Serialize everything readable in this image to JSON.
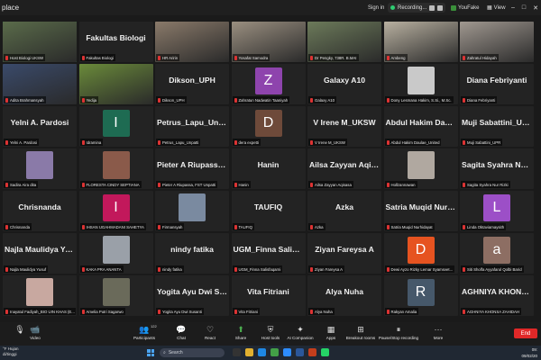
{
  "topbar": {
    "app_title": "place",
    "sign_in": "Sign in",
    "recording": "Recording...",
    "youfake": "YouFake",
    "view": "View",
    "minimize": "–",
    "maximize": "□",
    "close": "✕"
  },
  "tiles": [
    {
      "label": "Host Biologi UKSW",
      "type": "video",
      "color": "#5a6b4a",
      "active": true
    },
    {
      "label": "Fakultas Biologi",
      "type": "text",
      "name": "Fakultas Biologi"
    },
    {
      "label": "HR Aririn",
      "type": "video",
      "color": "#8a7a6a"
    },
    {
      "label": "Yosafat Samodra",
      "type": "video",
      "color": "#9a8f80"
    },
    {
      "label": "Dr Pengky, 738R. B.MAI",
      "type": "video",
      "color": "#6c7a5a"
    },
    {
      "label": "Ambeng",
      "type": "video",
      "color": "#b8b0a0"
    },
    {
      "label": "Zahratul Hidayah",
      "type": "video",
      "color": "#a09890"
    },
    {
      "label": "Adita Brahmansyah",
      "type": "video",
      "color": "#3a4a6a"
    },
    {
      "label": "Yedija",
      "type": "video",
      "color": "#6a8a3a"
    },
    {
      "label": "Dikson_UPH",
      "type": "text",
      "name": "Dikson_UPH"
    },
    {
      "label": "Zahratun Nadwatin Taaniyah",
      "type": "avatar",
      "letter": "Z",
      "color": "#8e44ad"
    },
    {
      "label": "Galaxy A10",
      "type": "text",
      "name": "Galaxy A10"
    },
    {
      "label": "Dony Lesmana Hakim, S.Si., M.Sc.",
      "type": "photo",
      "color": "#c9c9c9"
    },
    {
      "label": "Diana Febriyanti",
      "type": "text",
      "name": "Diana Febriyanti"
    },
    {
      "label": "Yelni A. Pardosi",
      "type": "text",
      "name": "Yelni A. Pardosi"
    },
    {
      "label": "Idramina",
      "type": "avatar",
      "letter": "I",
      "color": "#1e6b52"
    },
    {
      "label": "Petrus_Lapu_Unpatti",
      "type": "text",
      "name": "Petrus_Lapu_Unpatti"
    },
    {
      "label": "dera expetti",
      "type": "avatar",
      "letter": "D",
      "color": "#6e4a3a"
    },
    {
      "label": "V Irene M_UKSW",
      "type": "text",
      "name": "V Irene M_UKSW"
    },
    {
      "label": "Abdul Hakim Daulae_United",
      "type": "text",
      "name": "Abdul Hakim Daulae_United"
    },
    {
      "label": "Muji Sabattini_UPR",
      "type": "text",
      "name": "Muji Sabattini_UPR"
    },
    {
      "label": "Sadira Aira dita",
      "type": "photo",
      "color": "#8a7aa8"
    },
    {
      "label": "FLORESTA CINDY SEPTIANA",
      "type": "photo",
      "color": "#8a5a4a"
    },
    {
      "label": "Pieter A Riupassa, FST Unpatti",
      "type": "text",
      "name": "Pieter A Riupassa, FST Unpatti"
    },
    {
      "label": "Hanin",
      "type": "text",
      "name": "Hanin"
    },
    {
      "label": "Ailsa Zayyan Aqisasa",
      "type": "text",
      "name": "Ailsa Zayyan Aqisasa"
    },
    {
      "label": "Hollzannawan",
      "type": "photo",
      "color": "#b0a8a0"
    },
    {
      "label": "Sagita Syahra Nur Rizki",
      "type": "text",
      "name": "Sagita Syahra Nur Rizki"
    },
    {
      "label": "Chrisnanda",
      "type": "text",
      "name": "Chrisnanda"
    },
    {
      "label": "IHSAN UGAHMADANI SAHETYA",
      "type": "avatar",
      "letter": "I",
      "color": "#c2185b"
    },
    {
      "label": "Firmansyah",
      "type": "photo",
      "color": "#7a8aa0"
    },
    {
      "label": "TAUFIQ",
      "type": "text",
      "name": "TAUFIQ"
    },
    {
      "label": "Azka",
      "type": "text",
      "name": "Azka"
    },
    {
      "label": "Satria Muqid Nurhidayat",
      "type": "text",
      "name": "Satria Muqid Nurhidayat"
    },
    {
      "label": "Linda Oktaviamaysith",
      "type": "avatar",
      "letter": "L",
      "color": "#9c4fc7"
    },
    {
      "label": "Najla Maulidya Yusuf",
      "type": "text",
      "name": "Najla Maulidya Yusuf"
    },
    {
      "label": "KAKA PRA ANANTA",
      "type": "photo",
      "color": "#9aa0a8"
    },
    {
      "label": "nindy fatika",
      "type": "text",
      "name": "nindy fatika"
    },
    {
      "label": "UGM_Finna Salisfaqarni",
      "type": "text",
      "name": "UGM_Finna Salisfaqarni"
    },
    {
      "label": "Ziyan Fareysa A",
      "type": "text",
      "name": "Ziyan Fareysa A"
    },
    {
      "label": "Dewi Ayzo Rizky Lemar Syamsvet...",
      "type": "avatar",
      "letter": "D",
      "color": "#e65320"
    },
    {
      "label": "Siti Sholfa Ayyafarul Qolbi Barid",
      "type": "avatar",
      "letter": "a",
      "color": "#8d6e63"
    },
    {
      "label": "Inayatul Fadiyah_BIO UIN KHAS (E...",
      "type": "photo",
      "color": "#c8a8a0"
    },
    {
      "label": "Amelia Putri Sagarwo",
      "type": "photo",
      "color": "#6a6a5a"
    },
    {
      "label": "Yogita Ayu Dwi Susanti",
      "type": "text",
      "name": "Yogita Ayu Dwi Susanti"
    },
    {
      "label": "Vita Fitriani",
      "type": "text",
      "name": "Vita Fitriani"
    },
    {
      "label": "Alya Nuha",
      "type": "text",
      "name": "Alya Nuha"
    },
    {
      "label": "Rakyan Amalia",
      "type": "avatar",
      "letter": "R",
      "color": "#46586a"
    },
    {
      "label": "AGHNIYA KHONSA ZAHIDAH",
      "type": "text",
      "name": "AGHNIYA KHONSA ZAHIDAH"
    }
  ],
  "toolbar": {
    "audio_label": "",
    "video_label": "Video",
    "participants_label": "Participants",
    "participants_count": "122",
    "chat_label": "Chat",
    "react_label": "React",
    "share_label": "Share",
    "host_tools_label": "Host tools",
    "ai_label": "AI Companion",
    "apps_label": "Apps",
    "breakout_label": "Breakout rooms",
    "pause_label": "Pause/Stop recording",
    "more_label": "More",
    "end_label": "End"
  },
  "taskbar": {
    "weather_line1": "°F Hujan",
    "weather_line2": "di/tinggi",
    "search_placeholder": "Search",
    "time": "09:",
    "date": "09/02/20"
  },
  "colors": {
    "active_border": "#2ecc71",
    "end_button": "#e02828",
    "mic_muted": "#dd3333"
  }
}
